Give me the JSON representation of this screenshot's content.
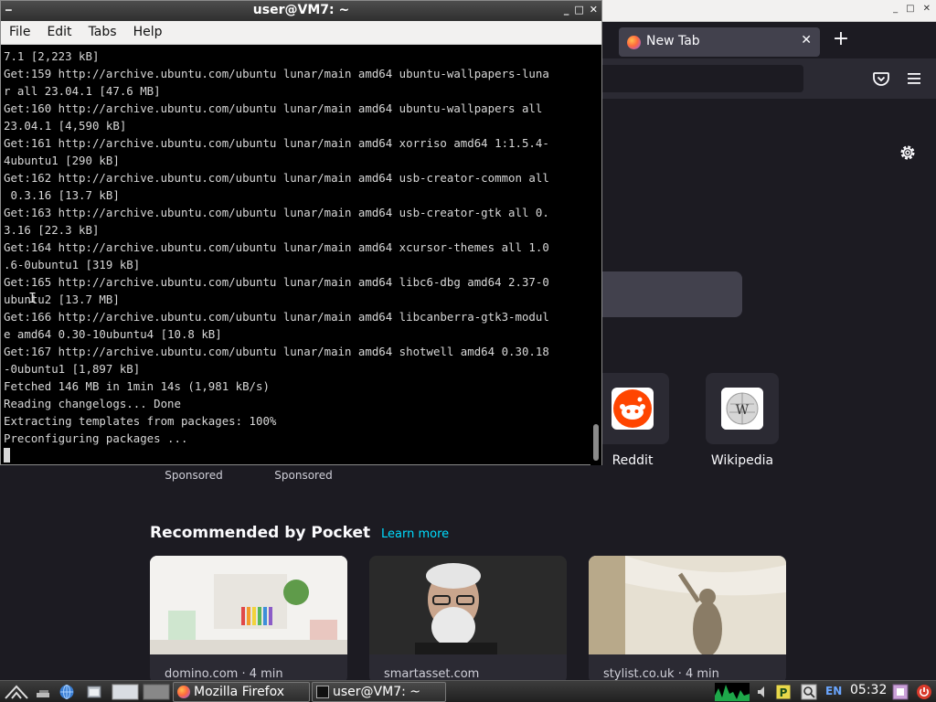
{
  "firefox": {
    "tab_title": "New Tab",
    "shortcuts": [
      {
        "label": "Reddit"
      },
      {
        "label": "Wikipedia"
      }
    ],
    "sponsored_label_1": "Sponsored",
    "sponsored_label_2": "Sponsored",
    "pocket": {
      "heading": "Recommended by Pocket",
      "learn_more": "Learn more",
      "cards": [
        {
          "source": "domino.com · 4 min"
        },
        {
          "source": "smartasset.com"
        },
        {
          "source": "stylist.co.uk · 4 min"
        }
      ]
    }
  },
  "terminal": {
    "title": "user@VM7: ~",
    "menu": {
      "file": "File",
      "edit": "Edit",
      "tabs": "Tabs",
      "help": "Help"
    },
    "lines": [
      "7.1 [2,223 kB]",
      "Get:159 http://archive.ubuntu.com/ubuntu lunar/main amd64 ubuntu-wallpapers-luna",
      "r all 23.04.1 [47.6 MB]",
      "Get:160 http://archive.ubuntu.com/ubuntu lunar/main amd64 ubuntu-wallpapers all",
      "23.04.1 [4,590 kB]",
      "Get:161 http://archive.ubuntu.com/ubuntu lunar/main amd64 xorriso amd64 1:1.5.4-",
      "4ubuntu1 [290 kB]",
      "Get:162 http://archive.ubuntu.com/ubuntu lunar/main amd64 usb-creator-common all",
      " 0.3.16 [13.7 kB]",
      "Get:163 http://archive.ubuntu.com/ubuntu lunar/main amd64 usb-creator-gtk all 0.",
      "3.16 [22.3 kB]",
      "Get:164 http://archive.ubuntu.com/ubuntu lunar/main amd64 xcursor-themes all 1.0",
      ".6-0ubuntu1 [319 kB]",
      "Get:165 http://archive.ubuntu.com/ubuntu lunar/main amd64 libc6-dbg amd64 2.37-0",
      "ubuntu2 [13.7 MB]",
      "Get:166 http://archive.ubuntu.com/ubuntu lunar/main amd64 libcanberra-gtk3-modul",
      "e amd64 0.30-10ubuntu4 [10.8 kB]",
      "Get:167 http://archive.ubuntu.com/ubuntu lunar/main amd64 shotwell amd64 0.30.18",
      "-0ubuntu1 [1,897 kB]",
      "Fetched 146 MB in 1min 14s (1,981 kB/s)",
      "Reading changelogs... Done",
      "Extracting templates from packages: 100%",
      "Preconfiguring packages ..."
    ]
  },
  "taskbar": {
    "tasks": [
      {
        "label": "Mozilla Firefox"
      },
      {
        "label": "user@VM7: ~"
      }
    ],
    "language": "EN",
    "clock": "05:32"
  },
  "colors": {
    "firefox_bg": "#1c1b22",
    "pocket_link": "#00ddff",
    "reddit": "#ff4500"
  }
}
